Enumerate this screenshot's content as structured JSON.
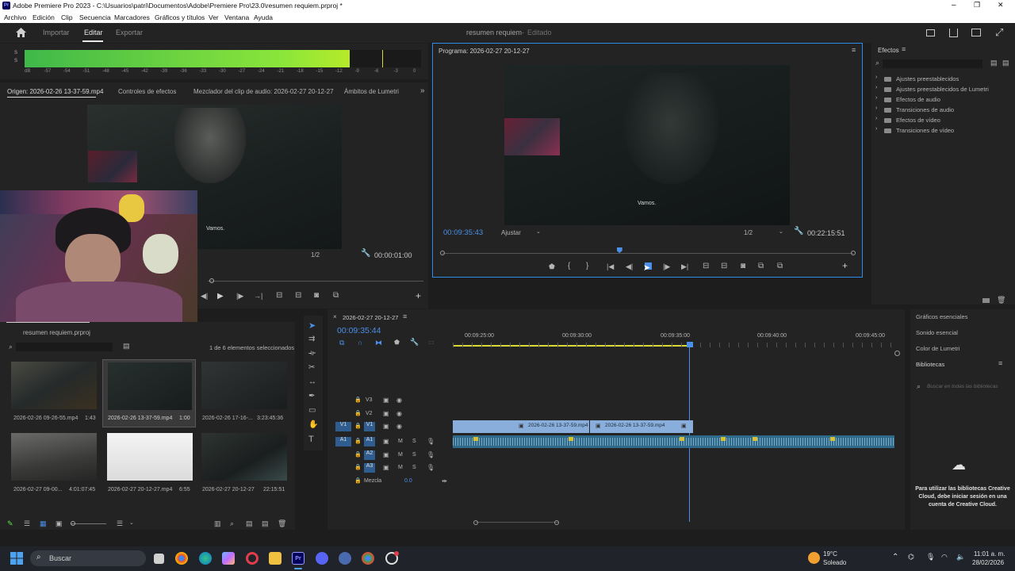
{
  "window": {
    "title": "Adobe Premiere Pro 2023 - C:\\Usuarios\\patri\\Documentos\\Adobe\\Premiere Pro\\23.0\\resumen requiem.prproj *",
    "controls": [
      "–",
      "❐",
      "✕"
    ]
  },
  "menu": [
    "Archivo",
    "Edición",
    "Clip",
    "Secuencia",
    "Marcadores",
    "Gráficos y títulos",
    "Ver",
    "Ventana",
    "Ayuda"
  ],
  "header": {
    "home_icon": "home-icon",
    "tabs": [
      "Importar",
      "Editar",
      "Exportar"
    ],
    "active_tab": "Editar",
    "project_title": "resumen requiem",
    "separator": "-",
    "status": "Editado"
  },
  "audio_meter": {
    "labels": [
      "S",
      "S"
    ],
    "ticks": [
      "dB",
      "-57",
      "-54",
      "-51",
      "-48",
      "-45",
      "-42",
      "-39",
      "-36",
      "-33",
      "-30",
      "-27",
      "-24",
      "-21",
      "-18",
      "-15",
      "-12",
      "-9",
      "-6",
      "-3",
      "0"
    ],
    "level_fraction": 0.82
  },
  "source_panel": {
    "tabs": [
      "Origen: 2026-02-26 13-37-59.mp4",
      "Controles de efectos",
      "Mezclador del clip de audio: 2026-02-27 20-12-27",
      "Ámbitos de Lumetri"
    ],
    "caption": "Vamos.",
    "resolution": "1/2",
    "timecode": "00:00:01:00"
  },
  "program_panel": {
    "title": "Programa: 2026-02-27 20-12-27",
    "caption": "Vamos.",
    "timecode": "00:09:35:43",
    "fit": "Ajustar",
    "resolution": "1/2",
    "duration": "00:22:15:51",
    "playhead_fraction": 0.43
  },
  "effects_panel": {
    "title": "Efectos",
    "items": [
      "Ajustes preestablecidos",
      "Ajustes preestablecidos de Lumetri",
      "Efectos de audio",
      "Transiciones de audio",
      "Efectos de vídeo",
      "Transiciones de vídeo"
    ]
  },
  "project_panel": {
    "project_name": "resumen requiem.prproj",
    "selection_info": "1 de 6 elementos seleccionados",
    "items": [
      {
        "name": "2026-02-26 09-26-55.mp4",
        "duration": "1:43"
      },
      {
        "name": "2026-02-26 13-37-59.mp4",
        "duration": "1:00"
      },
      {
        "name": "2026-02-26 17-16-...",
        "duration": "3:23:45:36"
      },
      {
        "name": "2026-02-27 09-00...",
        "duration": "4:01:07:45"
      },
      {
        "name": "2026-02-27 20-12-27.mp4",
        "duration": "6:55"
      },
      {
        "name": "2026-02-27 20-12-27",
        "duration": "22:15:51"
      }
    ]
  },
  "timeline": {
    "sequence_name": "2026-02-27 20-12-27",
    "timecode": "00:09:35:44",
    "ruler": [
      "00:09:25:00",
      "00:09:30:00",
      "00:09:35:00",
      "00:09:40:00",
      "00:09:45:00"
    ],
    "video_tracks": [
      "V3",
      "V2",
      "V1"
    ],
    "audio_tracks": [
      "A1",
      "A2",
      "A3"
    ],
    "source_patch_v": "V1",
    "source_patch_a": "A1",
    "mute_label": "M",
    "solo_label": "S",
    "mix_label": "Mezcla",
    "mix_value": "0.0",
    "clips": [
      "2026-02-26 13-37-59.mp4",
      "2026-02-26 13-37-59.mp4"
    ]
  },
  "right_panel": {
    "items": [
      "Gráficos esenciales",
      "Sonido esencial",
      "Color de Lumetri",
      "Bibliotecas"
    ],
    "search_placeholder": "Buscar en todas las bibliotecas",
    "message": "Para utilizar las bibliotecas Creative Cloud, debe iniciar sesión en una cuenta de Creative Cloud."
  },
  "taskbar": {
    "search_label": "Buscar",
    "weather_temp": "19°C",
    "weather_desc": "Soleado",
    "time": "11:01 a. m.",
    "date": "28/02/2026"
  },
  "colors": {
    "accent_blue": "#2d8ceb",
    "meter_green": "#5ee04a",
    "clip_blue": "#8aaedb",
    "audio_clip": "#2f6a8a"
  }
}
